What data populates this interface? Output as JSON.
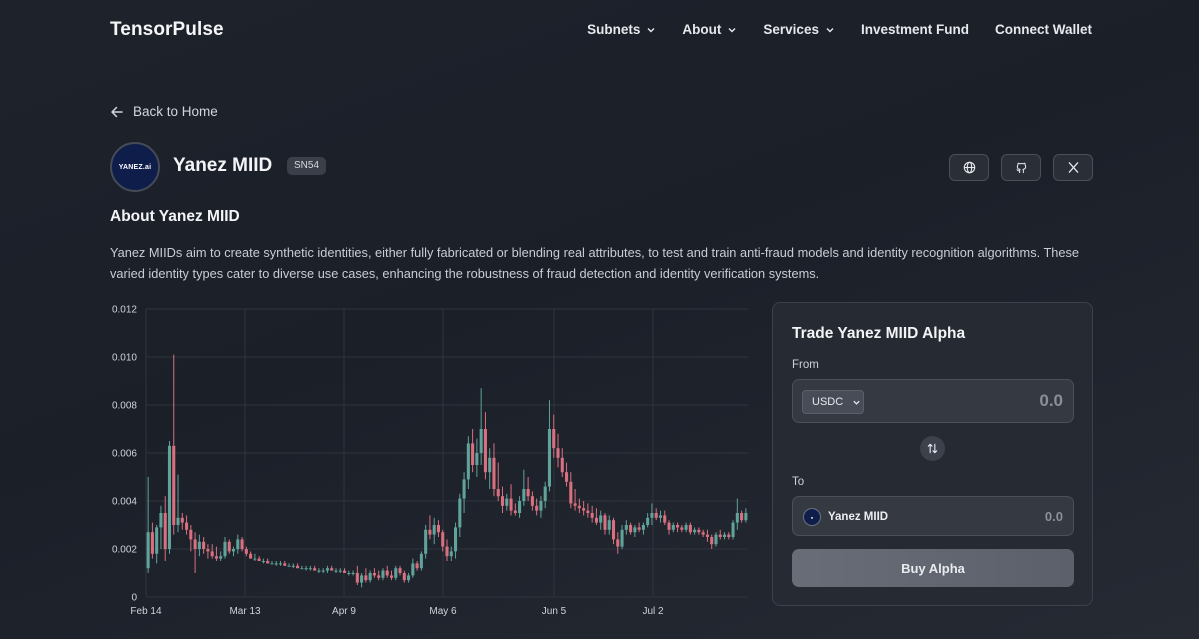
{
  "header": {
    "brand": "TensorPulse",
    "nav": [
      {
        "label": "Subnets",
        "dropdown": true
      },
      {
        "label": "About",
        "dropdown": true
      },
      {
        "label": "Services",
        "dropdown": true
      },
      {
        "label": "Investment Fund",
        "dropdown": false
      },
      {
        "label": "Connect Wallet",
        "dropdown": false
      }
    ]
  },
  "back_link": "Back to Home",
  "subnet": {
    "logo_text": "YANEZ.ai",
    "name": "Yanez MIID",
    "badge": "SN54",
    "social_icons": [
      "globe-icon",
      "github-icon",
      "x-icon"
    ]
  },
  "about": {
    "title": "About Yanez MIID",
    "text": "Yanez MIIDs aim to create synthetic identities, either fully fabricated or blending real attributes, to test and train anti-fraud models and identity recognition algorithms. These varied identity types cater to diverse use cases, enhancing the robustness of fraud detection and identity verification systems."
  },
  "trade": {
    "title": "Trade Yanez MIID Alpha",
    "from_label": "From",
    "from_token": "USDC",
    "from_placeholder": "0.0",
    "to_label": "To",
    "to_token": "Yanez MIID",
    "to_amount": "0.0",
    "buy_label": "Buy Alpha"
  },
  "colors": {
    "up": "#5fa39b",
    "down": "#d9707f",
    "grid": "#2f343d",
    "background": "#1e222b"
  },
  "chart_data": {
    "type": "candlestick",
    "x_ticks": [
      "Feb 14",
      "Mar 13",
      "Apr 9",
      "May 6",
      "Jun 5",
      "Jul 2"
    ],
    "y_ticks": [
      "0.012",
      "0.010",
      "0.008",
      "0.006",
      "0.004",
      "0.002",
      "0"
    ],
    "ylim": [
      0,
      0.012
    ],
    "grid": true,
    "series": [
      [
        0.0012,
        0.005,
        0.001,
        0.0027
      ],
      [
        0.0027,
        0.0031,
        0.0016,
        0.0018
      ],
      [
        0.0018,
        0.003,
        0.0014,
        0.0029
      ],
      [
        0.0029,
        0.0038,
        0.002,
        0.0035
      ],
      [
        0.0035,
        0.0042,
        0.0015,
        0.002
      ],
      [
        0.002,
        0.0065,
        0.0018,
        0.0063
      ],
      [
        0.0063,
        0.0101,
        0.0026,
        0.003
      ],
      [
        0.003,
        0.0051,
        0.0027,
        0.0033
      ],
      [
        0.0033,
        0.0035,
        0.0028,
        0.0031
      ],
      [
        0.0031,
        0.0034,
        0.0026,
        0.0028
      ],
      [
        0.0028,
        0.003,
        0.0019,
        0.0024
      ],
      [
        0.0024,
        0.0027,
        0.001,
        0.002
      ],
      [
        0.002,
        0.0026,
        0.0017,
        0.0023
      ],
      [
        0.0023,
        0.0025,
        0.0018,
        0.002
      ],
      [
        0.002,
        0.0022,
        0.0016,
        0.0019
      ],
      [
        0.0019,
        0.0022,
        0.0016,
        0.0017
      ],
      [
        0.0017,
        0.0021,
        0.0015,
        0.0016
      ],
      [
        0.0016,
        0.0019,
        0.0015,
        0.0017
      ],
      [
        0.0017,
        0.0025,
        0.0016,
        0.0023
      ],
      [
        0.0023,
        0.0024,
        0.0018,
        0.0019
      ],
      [
        0.0019,
        0.0021,
        0.0017,
        0.002
      ],
      [
        0.002,
        0.0026,
        0.0018,
        0.0024
      ],
      [
        0.0024,
        0.0025,
        0.0019,
        0.002
      ],
      [
        0.002,
        0.0021,
        0.0017,
        0.0018
      ],
      [
        0.0018,
        0.0019,
        0.0016,
        0.0016
      ],
      [
        0.0016,
        0.0018,
        0.0015,
        0.0016
      ],
      [
        0.0016,
        0.0017,
        0.0015,
        0.0015
      ],
      [
        0.0015,
        0.0016,
        0.0014,
        0.0015
      ],
      [
        0.0015,
        0.0016,
        0.0014,
        0.0014
      ],
      [
        0.0014,
        0.0015,
        0.0014,
        0.0014
      ],
      [
        0.0014,
        0.0015,
        0.0013,
        0.0014
      ],
      [
        0.0014,
        0.0015,
        0.0013,
        0.0014
      ],
      [
        0.0014,
        0.0015,
        0.0013,
        0.0013
      ],
      [
        0.0013,
        0.0014,
        0.0013,
        0.0013
      ],
      [
        0.0013,
        0.0014,
        0.0012,
        0.0013
      ],
      [
        0.0013,
        0.0014,
        0.0012,
        0.0012
      ],
      [
        0.0012,
        0.0013,
        0.0012,
        0.0012
      ],
      [
        0.0012,
        0.0013,
        0.0011,
        0.0012
      ],
      [
        0.0012,
        0.0013,
        0.0011,
        0.0012
      ],
      [
        0.0012,
        0.0013,
        0.0011,
        0.0011
      ],
      [
        0.0011,
        0.0012,
        0.001,
        0.0011
      ],
      [
        0.0011,
        0.0012,
        0.001,
        0.0011
      ],
      [
        0.0011,
        0.0013,
        0.001,
        0.0012
      ],
      [
        0.0012,
        0.0013,
        0.0011,
        0.0011
      ],
      [
        0.0011,
        0.0012,
        0.001,
        0.0011
      ],
      [
        0.0011,
        0.0012,
        0.001,
        0.0011
      ],
      [
        0.0011,
        0.0012,
        0.001,
        0.001
      ],
      [
        0.001,
        0.0011,
        0.0009,
        0.001
      ],
      [
        0.001,
        0.0011,
        0.0009,
        0.001
      ],
      [
        0.001,
        0.0013,
        0.0005,
        0.0006
      ],
      [
        0.0006,
        0.001,
        0.0004,
        0.0009
      ],
      [
        0.0009,
        0.0012,
        0.0006,
        0.0007
      ],
      [
        0.0007,
        0.0011,
        0.0006,
        0.001
      ],
      [
        0.001,
        0.0012,
        0.0008,
        0.0009
      ],
      [
        0.0009,
        0.0011,
        0.0007,
        0.0008
      ],
      [
        0.0008,
        0.0012,
        0.0007,
        0.0011
      ],
      [
        0.0011,
        0.0013,
        0.0008,
        0.0009
      ],
      [
        0.0009,
        0.0011,
        0.0007,
        0.0008
      ],
      [
        0.0008,
        0.0013,
        0.0007,
        0.0012
      ],
      [
        0.0012,
        0.0013,
        0.0009,
        0.001
      ],
      [
        0.001,
        0.0011,
        0.0006,
        0.0007
      ],
      [
        0.0007,
        0.001,
        0.0006,
        0.0009
      ],
      [
        0.0009,
        0.0016,
        0.0008,
        0.0014
      ],
      [
        0.0014,
        0.0015,
        0.0011,
        0.0012
      ],
      [
        0.0012,
        0.0019,
        0.0011,
        0.0018
      ],
      [
        0.0018,
        0.003,
        0.0016,
        0.0028
      ],
      [
        0.0028,
        0.0034,
        0.0024,
        0.0026
      ],
      [
        0.0026,
        0.0033,
        0.0022,
        0.003
      ],
      [
        0.003,
        0.0032,
        0.0025,
        0.0027
      ],
      [
        0.0027,
        0.0028,
        0.0019,
        0.0021
      ],
      [
        0.0021,
        0.0024,
        0.0015,
        0.0017
      ],
      [
        0.0017,
        0.0021,
        0.0015,
        0.0019
      ],
      [
        0.0019,
        0.0031,
        0.0016,
        0.0029
      ],
      [
        0.0029,
        0.0043,
        0.0025,
        0.0041
      ],
      [
        0.0041,
        0.0052,
        0.0035,
        0.0049
      ],
      [
        0.0049,
        0.0067,
        0.0045,
        0.0064
      ],
      [
        0.0064,
        0.007,
        0.0052,
        0.0055
      ],
      [
        0.0055,
        0.0066,
        0.005,
        0.006
      ],
      [
        0.006,
        0.0087,
        0.0055,
        0.007
      ],
      [
        0.007,
        0.0077,
        0.0049,
        0.0052
      ],
      [
        0.0052,
        0.0062,
        0.0045,
        0.0058
      ],
      [
        0.0058,
        0.0064,
        0.0042,
        0.0045
      ],
      [
        0.0045,
        0.0056,
        0.004,
        0.0042
      ],
      [
        0.0042,
        0.0046,
        0.0035,
        0.0038
      ],
      [
        0.0038,
        0.0043,
        0.0036,
        0.0041
      ],
      [
        0.0041,
        0.0047,
        0.0034,
        0.0036
      ],
      [
        0.0036,
        0.0039,
        0.0034,
        0.0035
      ],
      [
        0.0035,
        0.0042,
        0.0033,
        0.004
      ],
      [
        0.004,
        0.0053,
        0.0038,
        0.0045
      ],
      [
        0.0045,
        0.005,
        0.004,
        0.0042
      ],
      [
        0.0042,
        0.0044,
        0.0036,
        0.0038
      ],
      [
        0.0038,
        0.0041,
        0.0034,
        0.0036
      ],
      [
        0.0036,
        0.0042,
        0.0033,
        0.004
      ],
      [
        0.004,
        0.0048,
        0.0037,
        0.0046
      ],
      [
        0.0046,
        0.0082,
        0.0044,
        0.007
      ],
      [
        0.007,
        0.0076,
        0.0058,
        0.0062
      ],
      [
        0.0062,
        0.0068,
        0.0054,
        0.0058
      ],
      [
        0.0058,
        0.0062,
        0.005,
        0.0052
      ],
      [
        0.0052,
        0.0056,
        0.0046,
        0.0048
      ],
      [
        0.0048,
        0.0052,
        0.0037,
        0.0039
      ],
      [
        0.0039,
        0.0045,
        0.0036,
        0.0038
      ],
      [
        0.0038,
        0.0041,
        0.0035,
        0.0037
      ],
      [
        0.0037,
        0.004,
        0.0034,
        0.0036
      ],
      [
        0.0036,
        0.0039,
        0.0033,
        0.0035
      ],
      [
        0.0035,
        0.0038,
        0.0031,
        0.0033
      ],
      [
        0.0033,
        0.0037,
        0.003,
        0.0031
      ],
      [
        0.0031,
        0.0036,
        0.0028,
        0.0034
      ],
      [
        0.0034,
        0.0035,
        0.0026,
        0.0028
      ],
      [
        0.0028,
        0.0034,
        0.0026,
        0.0032
      ],
      [
        0.0032,
        0.0033,
        0.0022,
        0.0024
      ],
      [
        0.0024,
        0.0027,
        0.0018,
        0.0021
      ],
      [
        0.0021,
        0.003,
        0.002,
        0.0028
      ],
      [
        0.0028,
        0.0032,
        0.0026,
        0.003
      ],
      [
        0.003,
        0.0031,
        0.0026,
        0.0027
      ],
      [
        0.0027,
        0.003,
        0.0025,
        0.0029
      ],
      [
        0.0029,
        0.0031,
        0.0027,
        0.0028
      ],
      [
        0.0028,
        0.0031,
        0.0026,
        0.003
      ],
      [
        0.003,
        0.0035,
        0.0029,
        0.0033
      ],
      [
        0.0033,
        0.0039,
        0.003,
        0.0035
      ],
      [
        0.0035,
        0.0037,
        0.0032,
        0.0033
      ],
      [
        0.0033,
        0.0036,
        0.0031,
        0.0034
      ],
      [
        0.0034,
        0.0036,
        0.003,
        0.0031
      ],
      [
        0.0031,
        0.0032,
        0.0026,
        0.0028
      ],
      [
        0.0028,
        0.0031,
        0.0027,
        0.003
      ],
      [
        0.003,
        0.0031,
        0.0027,
        0.0029
      ],
      [
        0.0029,
        0.003,
        0.0027,
        0.0028
      ],
      [
        0.0028,
        0.0031,
        0.0027,
        0.003
      ],
      [
        0.003,
        0.0031,
        0.0026,
        0.0027
      ],
      [
        0.0027,
        0.0029,
        0.0026,
        0.0028
      ],
      [
        0.0028,
        0.0029,
        0.0026,
        0.0027
      ],
      [
        0.0027,
        0.0028,
        0.0025,
        0.0026
      ],
      [
        0.0026,
        0.0028,
        0.0023,
        0.0025
      ],
      [
        0.0025,
        0.0026,
        0.002,
        0.0022
      ],
      [
        0.0022,
        0.0027,
        0.0021,
        0.0026
      ],
      [
        0.0026,
        0.0028,
        0.0024,
        0.0025
      ],
      [
        0.0025,
        0.0027,
        0.0024,
        0.0026
      ],
      [
        0.0026,
        0.0027,
        0.0024,
        0.0025
      ],
      [
        0.0025,
        0.0032,
        0.0024,
        0.0031
      ],
      [
        0.0031,
        0.0041,
        0.0028,
        0.0035
      ],
      [
        0.0035,
        0.0036,
        0.0031,
        0.0032
      ],
      [
        0.0032,
        0.0037,
        0.0031,
        0.0035
      ]
    ]
  }
}
